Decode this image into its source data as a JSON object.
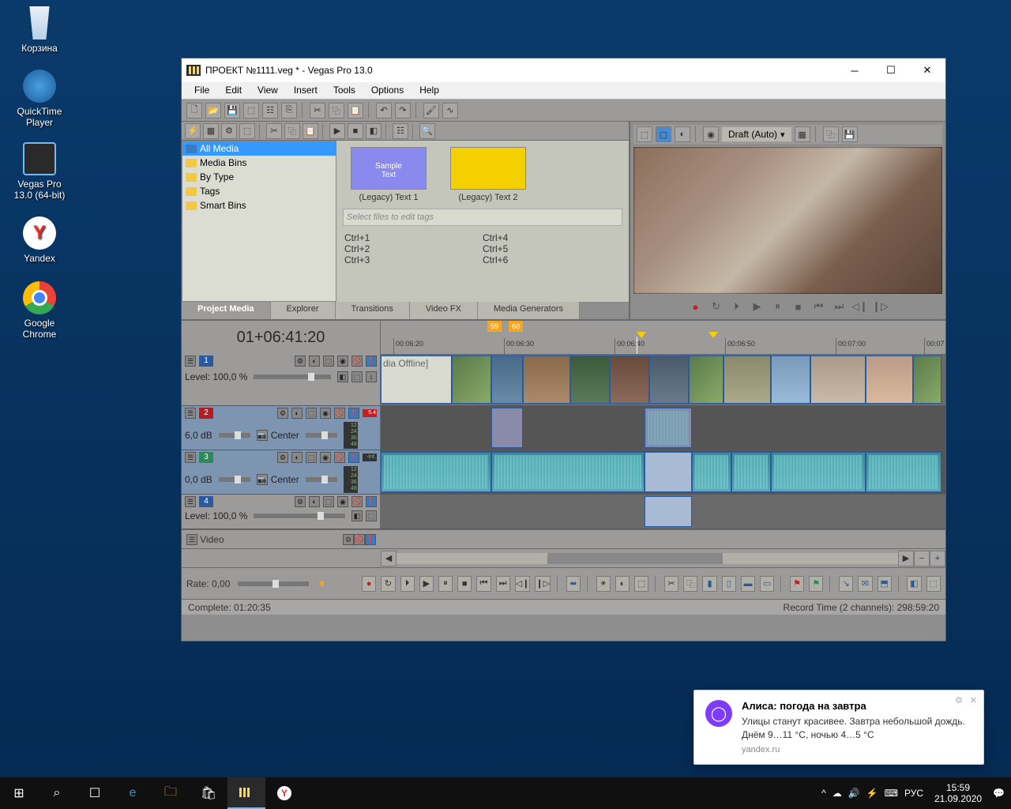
{
  "desktop_icons": [
    "Корзина",
    "QuickTime Player",
    "Vegas Pro 13.0 (64-bit)",
    "Yandex",
    "Google Chrome"
  ],
  "window": {
    "title": "ПРОЕКТ №1111.veg * - Vegas Pro 13.0",
    "menu": [
      "File",
      "Edit",
      "View",
      "Insert",
      "Tools",
      "Options",
      "Help"
    ]
  },
  "media_tree": [
    "All Media",
    "Media Bins",
    "By Type",
    "Tags",
    "Smart Bins"
  ],
  "media_tabs": [
    "Project Media",
    "Explorer",
    "Transitions",
    "Video FX",
    "Media Generators"
  ],
  "preview_items": [
    "(Legacy) Text 1",
    "(Legacy) Text 2"
  ],
  "filter_placeholder": "Select files to edit tags",
  "hotkeys": [
    "Ctrl+1",
    "Ctrl+4",
    "Ctrl+2",
    "Ctrl+5",
    "Ctrl+3",
    "Ctrl+6"
  ],
  "preview": {
    "quality": "Draft (Auto)"
  },
  "timeline": {
    "position": "01+06:41:20",
    "markers": [
      "59",
      "60"
    ],
    "ticks": [
      "00:06:20",
      "00:06:30",
      "00:06:40",
      "00:06:50",
      "00:07:00",
      "00:07"
    ]
  },
  "tracks": {
    "t1": {
      "num": "1",
      "level": "Level: 100,0 %"
    },
    "t2": {
      "num": "2",
      "vol": "6,0 dB",
      "pan": "Center",
      "meter": "5.4"
    },
    "t3": {
      "num": "3",
      "vol": "0,0 dB",
      "pan": "Center",
      "meter": "-Inf."
    },
    "t4": {
      "num": "4",
      "level": "Level: 100,0 %"
    },
    "bus": {
      "label": "Video"
    },
    "meter_ticks": "12\n24\n36\n48"
  },
  "offline_label": "dia Offline]",
  "rate": "Rate: 0,00",
  "status": {
    "left": "Complete: 01:20:35",
    "right": "Record Time (2 channels): 298:59:20"
  },
  "notification": {
    "title": "Алиса: погода на завтра",
    "body": "Улицы станут красивее. Завтра небольшой дождь. Днём 9…11 °C, ночью 4…5 °C",
    "source": "yandex.ru"
  },
  "taskbar": {
    "lang": "РУС",
    "time": "15:59",
    "date": "21.09.2020"
  }
}
